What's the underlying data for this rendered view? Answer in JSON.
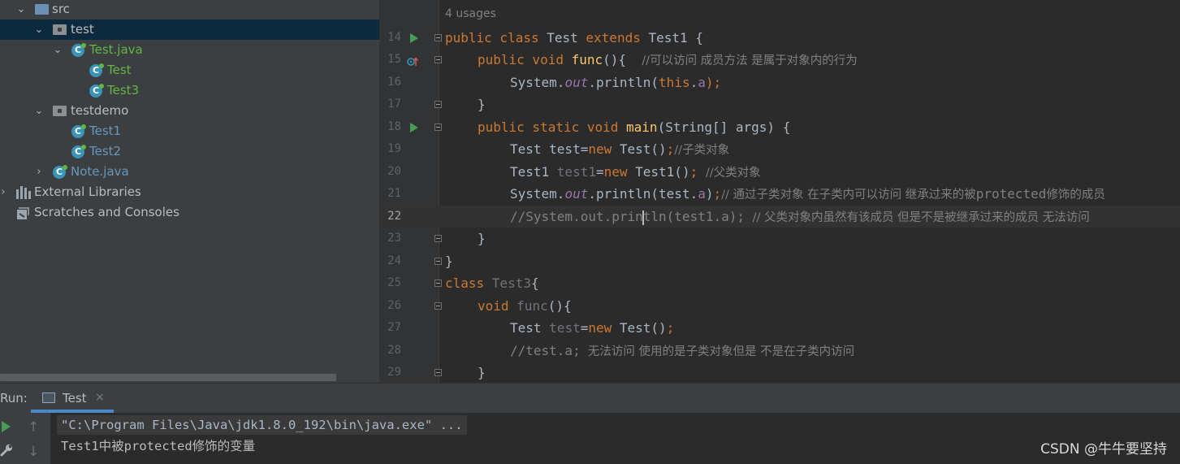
{
  "project_tree": {
    "items": [
      {
        "label": "src",
        "expanded": true,
        "icon": "source-folder-icon"
      },
      {
        "label": "test",
        "expanded": true,
        "icon": "package-icon",
        "selected": true
      },
      {
        "label": "Test.java",
        "expanded": true,
        "icon": "java-class-icon"
      },
      {
        "label": "Test",
        "icon": "java-class-icon"
      },
      {
        "label": "Test3",
        "icon": "java-class-icon"
      },
      {
        "label": "testdemo",
        "expanded": true,
        "icon": "package-icon"
      },
      {
        "label": "Test1",
        "icon": "java-class-icon"
      },
      {
        "label": "Test2",
        "icon": "java-class-icon"
      },
      {
        "label": "Note.java",
        "expanded": false,
        "icon": "java-class-icon"
      },
      {
        "label": "External Libraries",
        "expanded": false,
        "icon": "library-icon"
      },
      {
        "label": "Scratches and Consoles",
        "icon": "scratches-icon"
      }
    ]
  },
  "editor": {
    "usages_hint": "4 usages",
    "current_line": "22",
    "lines": [
      {
        "num": "14",
        "parts": [
          "public class ",
          "Test ",
          "extends ",
          "Test1 {"
        ]
      },
      {
        "num": "15",
        "parts": [
          "public void ",
          "func",
          "(){  ",
          "//可以访问 成员方法 是属于对象内的行为"
        ]
      },
      {
        "num": "16",
        "parts": [
          "System.",
          "out",
          ".println(",
          "this",
          ".",
          "a",
          ");"
        ]
      },
      {
        "num": "17",
        "parts": [
          "}"
        ]
      },
      {
        "num": "18",
        "parts": [
          "public static void ",
          "main",
          "(String[] args) {"
        ]
      },
      {
        "num": "19",
        "parts": [
          "Test test=",
          "new ",
          "Test()",
          ";",
          "//子类对象"
        ]
      },
      {
        "num": "20",
        "parts": [
          "Test1 ",
          "test1",
          "=",
          "new ",
          "Test1()",
          "; ",
          "//父类对象"
        ]
      },
      {
        "num": "21",
        "parts": [
          "System.",
          "out",
          ".println(test.",
          "a",
          ")",
          ";",
          "// 通过子类对象 在子类内可以访问 继承过来的被",
          "protected",
          "修饰的成员"
        ]
      },
      {
        "num": "22",
        "parts": [
          "//System.out.prin",
          "tln(test1.a); ",
          "// 父类对象内虽然有该成员 但是不是被继承过来的成员 无法访问"
        ]
      },
      {
        "num": "23",
        "parts": [
          "}"
        ]
      },
      {
        "num": "24",
        "parts": [
          "}"
        ]
      },
      {
        "num": "25",
        "parts": [
          "class ",
          "Test3",
          "{"
        ]
      },
      {
        "num": "26",
        "parts": [
          "void ",
          "func",
          "(){"
        ]
      },
      {
        "num": "27",
        "parts": [
          "Test ",
          "test",
          "=",
          "new ",
          "Test()",
          ";"
        ]
      },
      {
        "num": "28",
        "parts": [
          "//test.a;",
          "  无法访问 使用的是子类对象但是 不是在子类内访问"
        ]
      },
      {
        "num": "29",
        "parts": [
          "}"
        ]
      }
    ]
  },
  "run_panel": {
    "label": "Run:",
    "tab_label": "Test",
    "tab_close": "×",
    "console": [
      "\"C:\\Program Files\\Java\\jdk1.8.0_192\\bin\\java.exe\" ...",
      "Test1中被protected修饰的变量"
    ],
    "up_arrow": "↑",
    "down_arrow": "↓",
    "wrench": "🔧"
  },
  "watermark": "CSDN @牛牛要坚持",
  "colors": {
    "keyword": "#cc7832",
    "function": "#ffc66d",
    "field": "#9876aa",
    "comment": "#808080",
    "run_green": "#499c54",
    "selection": "#0d293e"
  }
}
